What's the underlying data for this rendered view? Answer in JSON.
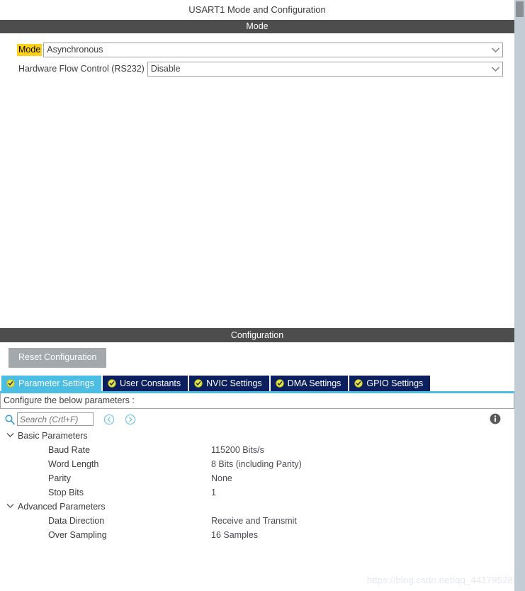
{
  "panel": {
    "title": "USART1 Mode and Configuration",
    "mode_section_title": "Mode",
    "configuration_section_title": "Configuration"
  },
  "mode_form": {
    "rows": [
      {
        "label": "Mode",
        "value": "Asynchronous",
        "highlighted": true
      },
      {
        "label": "Hardware Flow Control (RS232)",
        "value": "Disable",
        "highlighted": false
      }
    ]
  },
  "configuration": {
    "reset_button_label": "Reset Configuration",
    "tabs": [
      {
        "label": "Parameter Settings",
        "active": true
      },
      {
        "label": "User Constants",
        "active": false
      },
      {
        "label": "NVIC Settings",
        "active": false
      },
      {
        "label": "DMA Settings",
        "active": false
      },
      {
        "label": "GPIO Settings",
        "active": false
      }
    ],
    "notice": "Configure the below parameters :",
    "search": {
      "placeholder": "Search (Crtl+F)",
      "value": ""
    },
    "groups": [
      {
        "label": "Basic Parameters",
        "expanded": true,
        "params": [
          {
            "name": "Baud Rate",
            "value": "115200 Bits/s"
          },
          {
            "name": "Word Length",
            "value": "8 Bits (including Parity)"
          },
          {
            "name": "Parity",
            "value": "None"
          },
          {
            "name": "Stop Bits",
            "value": "1"
          }
        ]
      },
      {
        "label": "Advanced Parameters",
        "expanded": true,
        "params": [
          {
            "name": "Data Direction",
            "value": "Receive and Transmit"
          },
          {
            "name": "Over Sampling",
            "value": "16 Samples"
          }
        ]
      }
    ]
  },
  "watermark": "https://blog.csdn.net/qq_44179528",
  "colors": {
    "section_bar": "#4d4d4d",
    "tab_active": "#4cbee4",
    "tab_inactive": "#0c1f5e",
    "highlight": "#ffd21a",
    "accent": "#4cbee4",
    "scrollbar_track": "#c3ccd5"
  }
}
